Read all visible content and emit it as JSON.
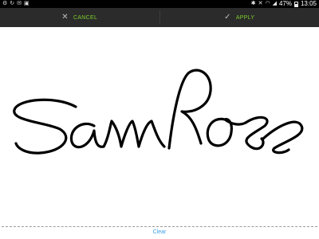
{
  "status_bar": {
    "battery": "47%",
    "time": "13:05",
    "left_icons": [
      "settings-icon",
      "sync-icon",
      "chat-icon",
      "notification-icon"
    ],
    "right_icons": [
      "bluetooth-icon",
      "mute-icon",
      "wifi-icon",
      "signal-icon",
      "battery-icon"
    ]
  },
  "action_bar": {
    "cancel_label": "CANCEL",
    "apply_label": "APPLY",
    "accent_color": "#7ccd2a",
    "background_color": "#2b2b2b"
  },
  "signature": {
    "text": "Sam Ross",
    "ink_color": "#000000"
  },
  "footer": {
    "clear_label": "Clear",
    "link_color": "#3aa0e6"
  }
}
